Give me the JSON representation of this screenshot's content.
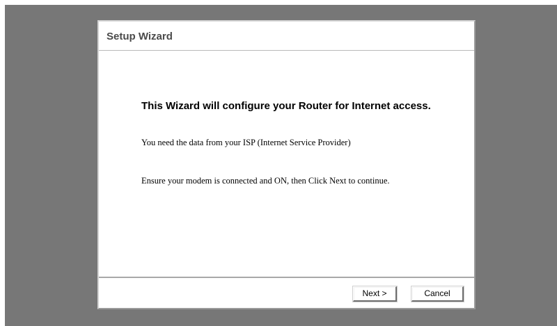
{
  "dialog": {
    "title": "Setup Wizard"
  },
  "body": {
    "heading": "This Wizard will configure your Router for Internet access.",
    "line1": "You need the data from your ISP (Internet Service Provider)",
    "line2": "Ensure your modem is connected and ON, then Click Next to continue."
  },
  "footer": {
    "next_label": "Next >",
    "cancel_label": "Cancel"
  },
  "colors": {
    "backdrop": "#777777",
    "dialog_background": "#ffffff",
    "title_text": "#4a4a4a"
  }
}
